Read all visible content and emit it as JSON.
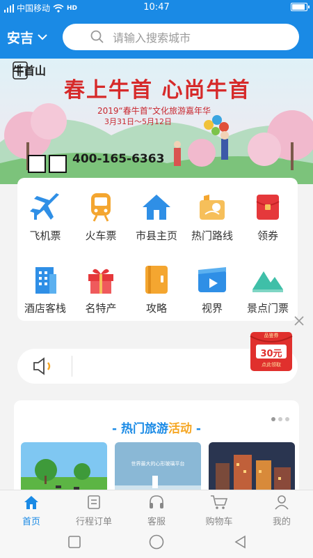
{
  "status": {
    "carrier": "中国移动",
    "time": "10:47",
    "network": "HD"
  },
  "header": {
    "city": "安吉",
    "search_placeholder": "请输入搜索城市"
  },
  "banner": {
    "headline": "春上牛首 心尚牛首",
    "subtitle": "2019“春牛首”文化旅游嘉年华",
    "dates": "3月31日～5月12日",
    "brand": "牛首山",
    "phone": "400-165-6363"
  },
  "services": [
    {
      "label": "飞机票",
      "icon": "airplane-icon"
    },
    {
      "label": "火车票",
      "icon": "train-icon"
    },
    {
      "label": "市县主页",
      "icon": "home-icon"
    },
    {
      "label": "热门路线",
      "icon": "map-icon"
    },
    {
      "label": "领券",
      "icon": "red-envelope-icon"
    },
    {
      "label": "酒店客栈",
      "icon": "hotel-icon"
    },
    {
      "label": "名特产",
      "icon": "gift-icon"
    },
    {
      "label": "攻略",
      "icon": "guide-book-icon"
    },
    {
      "label": "视界",
      "icon": "video-icon"
    },
    {
      "label": "景点门票",
      "icon": "mountain-icon"
    }
  ],
  "coupon": {
    "amount": "30元",
    "top_text": "品鉴券",
    "bottom_text": "点此领取"
  },
  "activity": {
    "title_main": "- 热门旅游",
    "title_highlight": "活动",
    "title_tail": " -",
    "card2_text": "世界最大的心形玻璃平台"
  },
  "tabs": [
    {
      "label": "首页",
      "icon": "home-tab-icon",
      "active": true
    },
    {
      "label": "行程订单",
      "icon": "order-icon",
      "active": false
    },
    {
      "label": "客服",
      "icon": "headset-icon",
      "active": false
    },
    {
      "label": "购物车",
      "icon": "cart-icon",
      "active": false
    },
    {
      "label": "我的",
      "icon": "user-icon",
      "active": false
    }
  ],
  "colors": {
    "primary": "#1a8ae5",
    "accent": "#f5a623",
    "coupon_red": "#e0302d"
  }
}
